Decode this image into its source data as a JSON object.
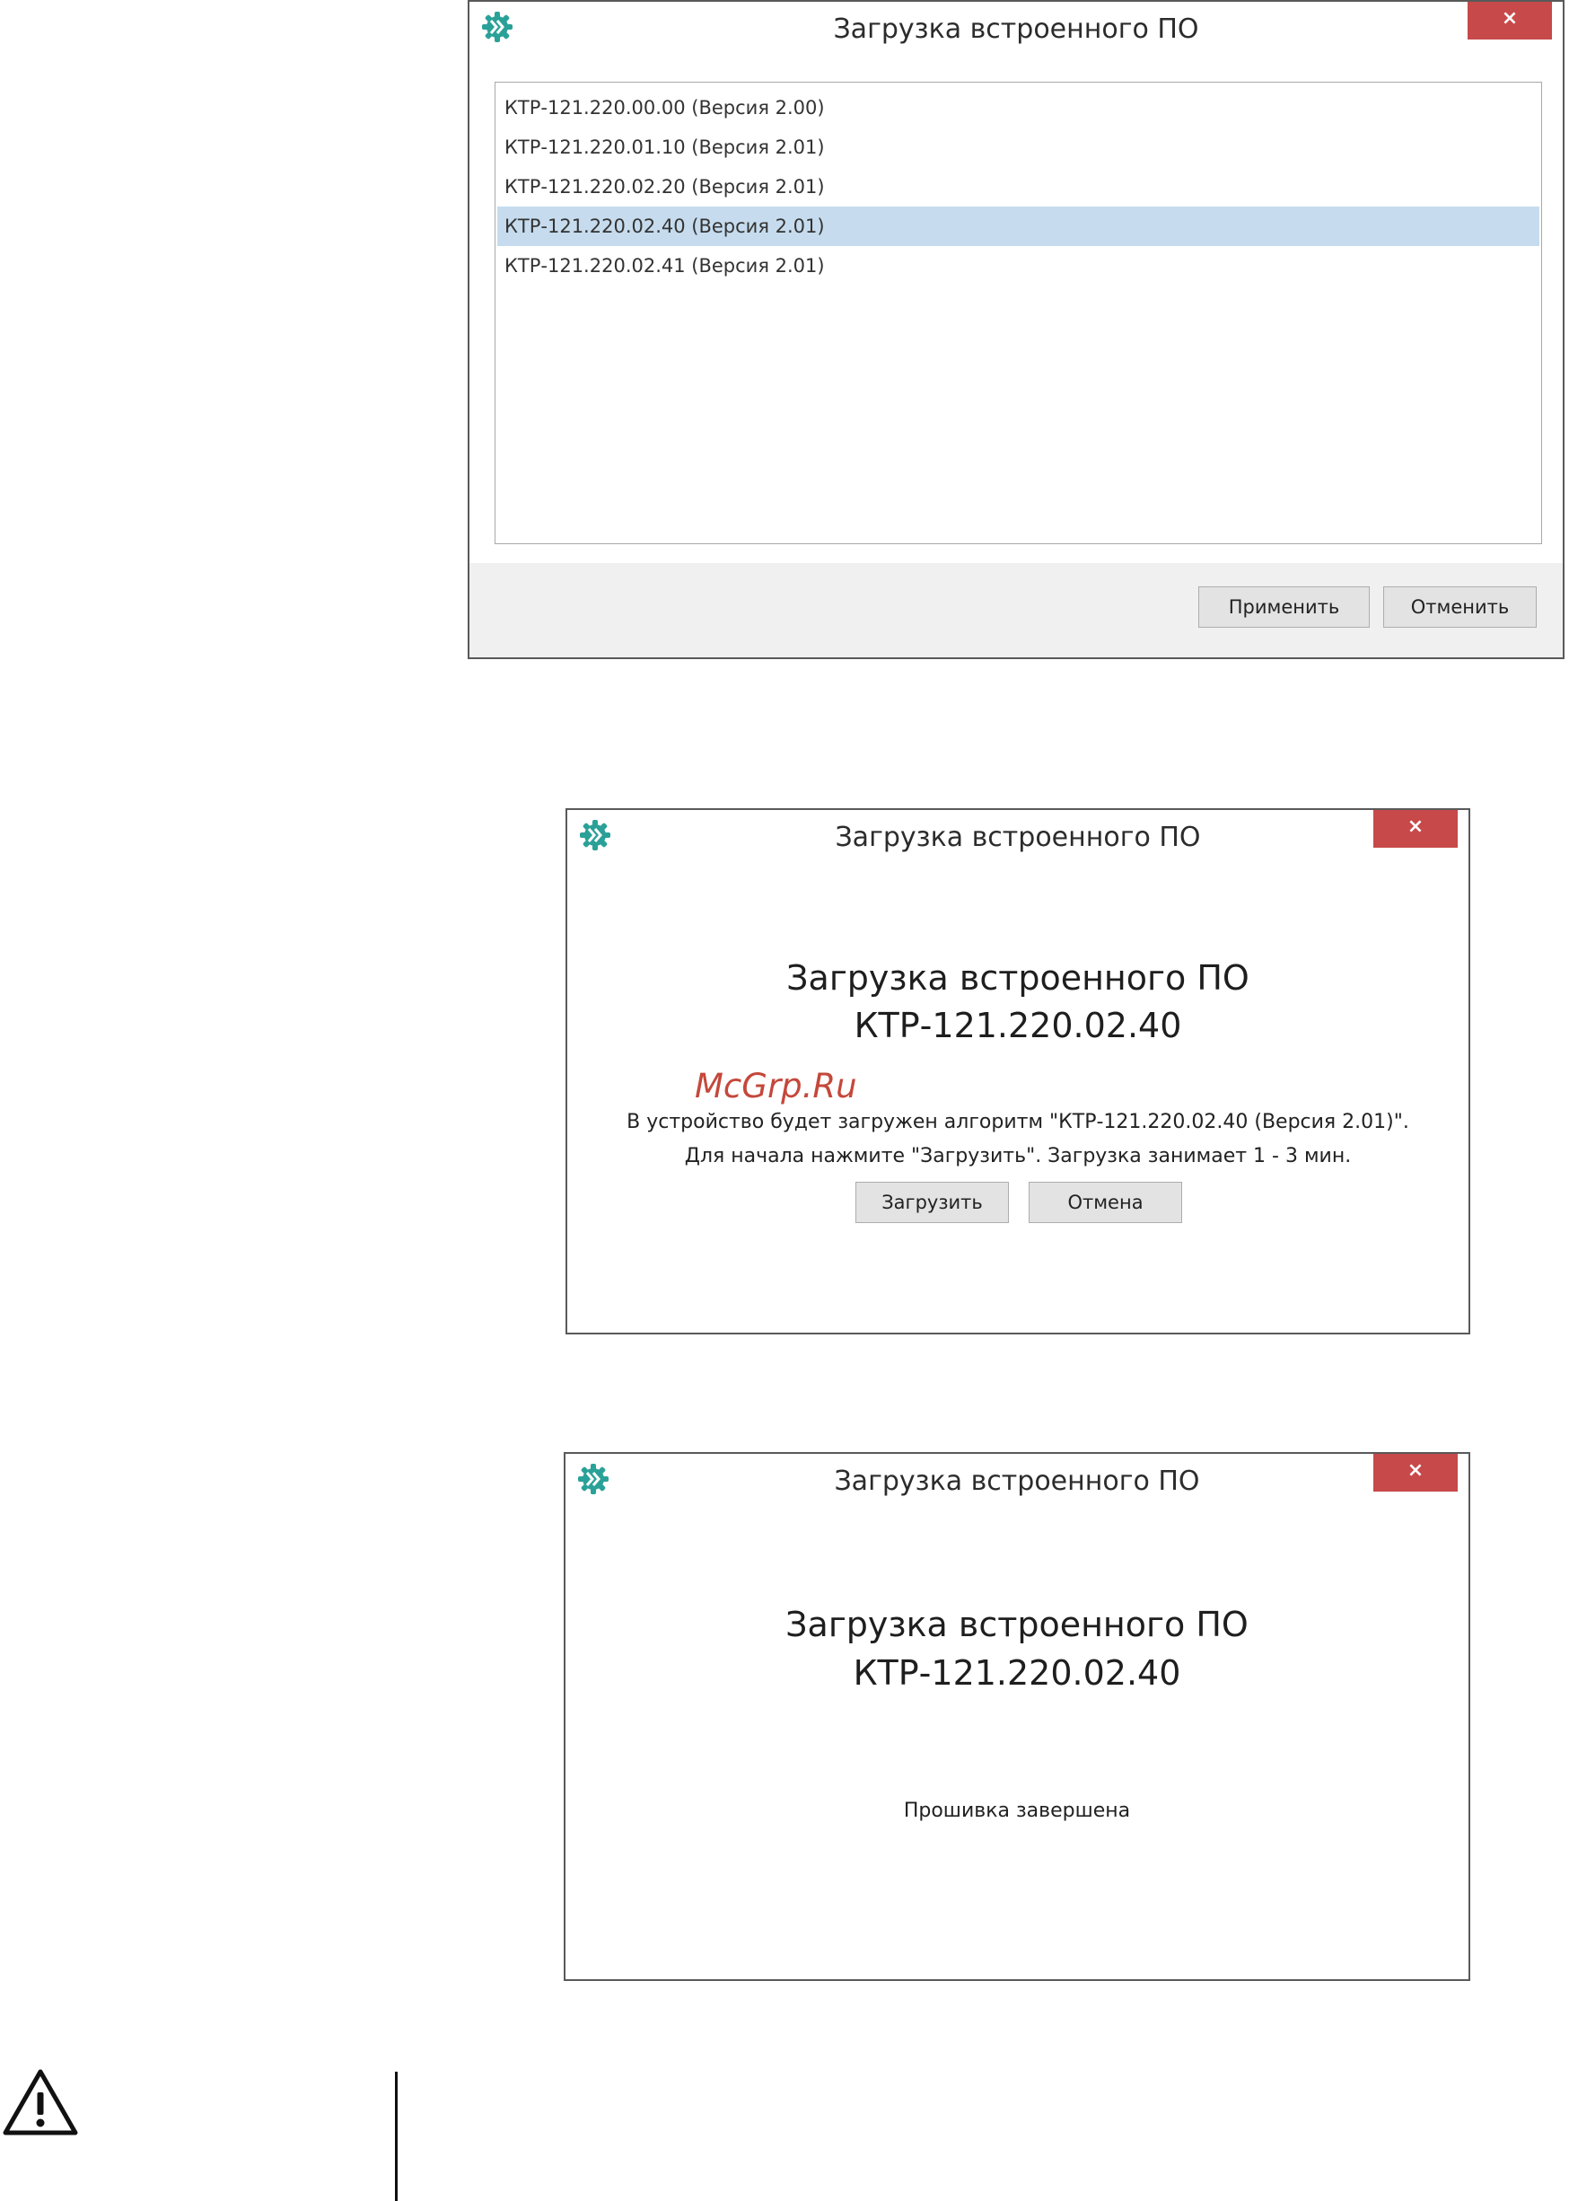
{
  "colors": {
    "close_button": "#c7494a",
    "selection": "#c6dcee",
    "watermark": "#c0392b",
    "app_icon": "#2aa198"
  },
  "icons": {
    "app": "app-logo-icon",
    "close": "close-icon",
    "caution": "warning-triangle-icon"
  },
  "dialog_select": {
    "title": "Загрузка встроенного ПО",
    "close_glyph": "×",
    "items": [
      {
        "label": "КТР-121.220.00.00 (Версия 2.00)",
        "selected": false
      },
      {
        "label": "КТР-121.220.01.10 (Версия 2.01)",
        "selected": false
      },
      {
        "label": "КТР-121.220.02.20 (Версия 2.01)",
        "selected": false
      },
      {
        "label": "КТР-121.220.02.40 (Версия 2.01)",
        "selected": true
      },
      {
        "label": "КТР-121.220.02.41 (Версия 2.01)",
        "selected": false
      }
    ],
    "apply_label": "Применить",
    "cancel_label": "Отменить"
  },
  "dialog_confirm": {
    "title": "Загрузка встроенного ПО",
    "close_glyph": "×",
    "heading_line1": "Загрузка встроенного ПО",
    "heading_line2": "КТР-121.220.02.40",
    "message_line1": "В устройство будет загружен алгоритм \"КТР-121.220.02.40 (Версия 2.01)\".",
    "message_line2": "Для начала нажмите \"Загрузить\". Загрузка занимает 1 - 3 мин.",
    "load_label": "Загрузить",
    "cancel_label": "Отмена"
  },
  "dialog_done": {
    "title": "Загрузка встроенного ПО",
    "close_glyph": "×",
    "heading_line1": "Загрузка встроенного ПО",
    "heading_line2": "КТР-121.220.02.40",
    "status": "Прошивка завершена"
  },
  "watermark": "McGrp.Ru"
}
